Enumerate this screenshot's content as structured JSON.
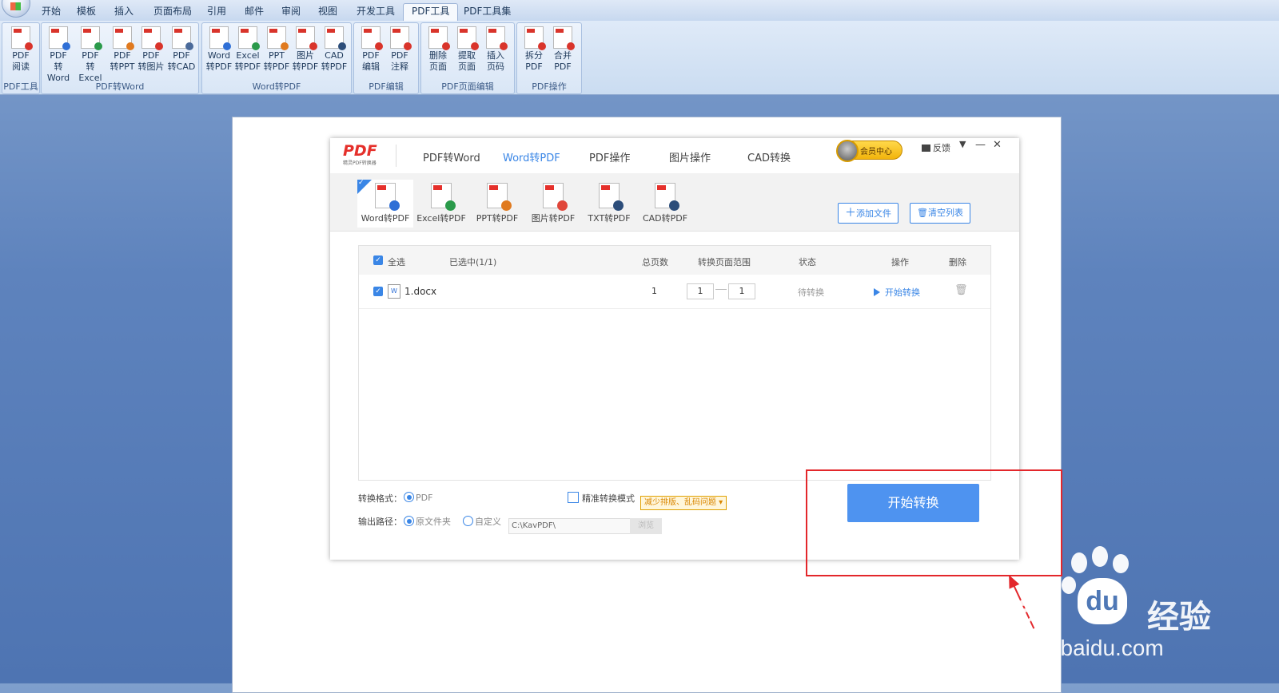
{
  "ribbon": {
    "tabs": [
      "开始",
      "模板",
      "插入",
      "页面布局",
      "引用",
      "邮件",
      "审阅",
      "视图",
      "开发工具",
      "PDF工具",
      "PDF工具集"
    ],
    "active_tab": "PDF工具",
    "groups": [
      {
        "label": "PDF工具",
        "buttons": [
          [
            "PDF",
            "阅读"
          ]
        ]
      },
      {
        "label": "PDF转Word",
        "buttons": [
          [
            "PDF",
            "转Word"
          ],
          [
            "PDF",
            "转Excel"
          ],
          [
            "PDF",
            "转PPT"
          ],
          [
            "PDF",
            "转图片"
          ],
          [
            "PDF",
            "转CAD"
          ]
        ]
      },
      {
        "label": "Word转PDF",
        "buttons": [
          [
            "Word",
            "转PDF"
          ],
          [
            "Excel",
            "转PDF"
          ],
          [
            "PPT",
            "转PDF"
          ],
          [
            "图片",
            "转PDF"
          ],
          [
            "CAD",
            "转PDF"
          ]
        ]
      },
      {
        "label": "PDF编辑",
        "buttons": [
          [
            "PDF",
            "编辑"
          ],
          [
            "PDF",
            "注释"
          ]
        ]
      },
      {
        "label": "PDF页面编辑",
        "buttons": [
          [
            "删除",
            "页面"
          ],
          [
            "提取",
            "页面"
          ],
          [
            "插入",
            "页码"
          ]
        ]
      },
      {
        "label": "PDF操作",
        "buttons": [
          [
            "拆分",
            "PDF"
          ],
          [
            "合并",
            "PDF"
          ]
        ]
      }
    ]
  },
  "app": {
    "logo": "PDF",
    "logo_sub": "精灵PDF转换器",
    "main_tabs": [
      "PDF转Word",
      "Word转PDF",
      "PDF操作",
      "图片操作",
      "CAD转换"
    ],
    "active_main_tab": "Word转PDF",
    "member_label": "会员中心",
    "feedback_label": "反馈",
    "modes": [
      "Word转PDF",
      "Excel转PDF",
      "PPT转PDF",
      "图片转PDF",
      "TXT转PDF",
      "CAD转PDF"
    ],
    "active_mode": "Word转PDF",
    "add_file": "添加文件",
    "clear_list": "清空列表",
    "table": {
      "select_all": "全选",
      "selected": "已选中(1/1)",
      "headers": {
        "pages": "总页数",
        "range": "转换页面范围",
        "status": "状态",
        "action": "操作",
        "delete": "删除"
      },
      "rows": [
        {
          "name": "1.docx",
          "pages": "1",
          "from": "1",
          "to": "1",
          "status": "待转换",
          "action": "开始转换"
        }
      ]
    },
    "format_label": "转换格式：",
    "format_value": "PDF",
    "precise_label": "精准转换模式",
    "precise_tag": "减少排版、乱码问题",
    "output_label": "输出路径：",
    "output_original": "原文件夹",
    "output_custom": "自定义",
    "output_path": "C:\\KavPDF\\",
    "browse": "浏览",
    "start_button": "开始转换"
  },
  "watermark": {
    "bai": "Bai",
    "du": "du",
    "jy": "经验",
    "url": "jingyan.baidu.com"
  },
  "colors": {
    "accent": "#3a86e6",
    "annotation": "#e3272b",
    "start": "#4e93f0"
  }
}
